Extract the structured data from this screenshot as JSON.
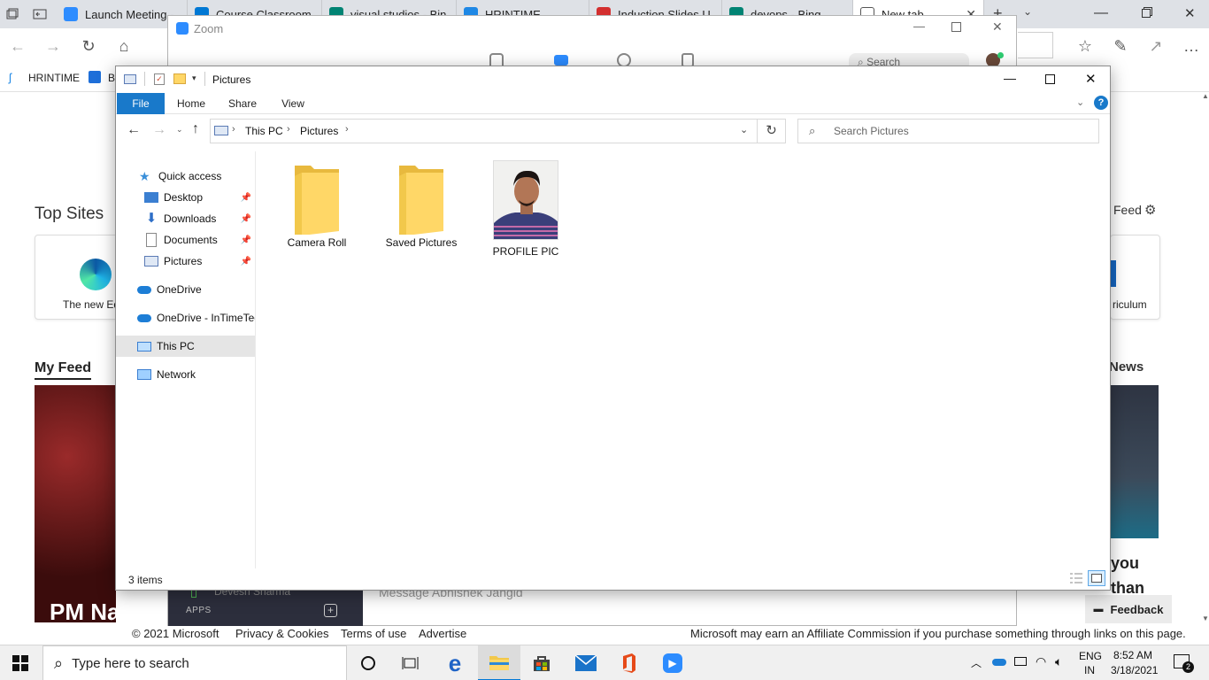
{
  "browser": {
    "tabs": [
      {
        "label": "Launch Meeting - ",
        "color": "#2d8cff"
      },
      {
        "label": "Course Classroom",
        "color": "#0078d4"
      },
      {
        "label": "visual studios - Bin",
        "color": "#008373"
      },
      {
        "label": "HRINTIME",
        "color": "#1e88e5"
      },
      {
        "label": "Induction Slides U",
        "color": "#d32f2f"
      },
      {
        "label": "devops - Bing",
        "color": "#008373"
      },
      {
        "label": "New tab",
        "color": "#555555"
      }
    ],
    "new_tab_plus": "+",
    "favorites": [
      {
        "label": "HRINTIME"
      },
      {
        "label": "B"
      }
    ],
    "ntp": {
      "top_sites_heading": "Top Sites",
      "feed_link": "Feed",
      "site_left_label": "The new Ed",
      "site_right_label": "riculum",
      "my_feed_tab": "My Feed",
      "news_tab": "News",
      "headline_left": "PM Narend",
      "headline_right_1": "you",
      "headline_right_2": "than"
    },
    "footer": {
      "copyright": "© 2021 Microsoft",
      "privacy": "Privacy & Cookies",
      "terms": "Terms of use",
      "advertise": "Advertise",
      "commission": "Microsoft may earn an Affiliate Commission if you purchase something through links on this page."
    },
    "feedback_label": "Feedback"
  },
  "zoom": {
    "title": "Zoom",
    "search_placeholder": "Search",
    "contact_name": "Devesh Sharma",
    "apps_label": "APPS",
    "message_placeholder": "Message Abhishek Jangid"
  },
  "explorer": {
    "title": "Pictures",
    "ribbon_tabs": {
      "file": "File",
      "home": "Home",
      "share": "Share",
      "view": "View"
    },
    "breadcrumb": [
      "This PC",
      "Pictures"
    ],
    "search_placeholder": "Search Pictures",
    "nav": {
      "quick_access": "Quick access",
      "desktop": "Desktop",
      "downloads": "Downloads",
      "documents": "Documents",
      "pictures": "Pictures",
      "onedrive": "OneDrive",
      "onedrive_org": "OneDrive - InTimeTec",
      "this_pc": "This PC",
      "network": "Network"
    },
    "items": [
      {
        "name": "Camera Roll",
        "type": "folder"
      },
      {
        "name": "Saved Pictures",
        "type": "folder"
      },
      {
        "name": "PROFILE PIC",
        "type": "image"
      }
    ],
    "status": "3 items"
  },
  "taskbar": {
    "search_placeholder": "Type here to search",
    "language": "ENG",
    "region": "IN",
    "time": "8:52 AM",
    "date": "3/18/2021",
    "notification_count": "2"
  },
  "colors": {
    "accent": "#0078d7",
    "file_tab": "#1979ca",
    "folder_yellow": "#ffd767",
    "zoom_blue": "#2d8cff"
  }
}
